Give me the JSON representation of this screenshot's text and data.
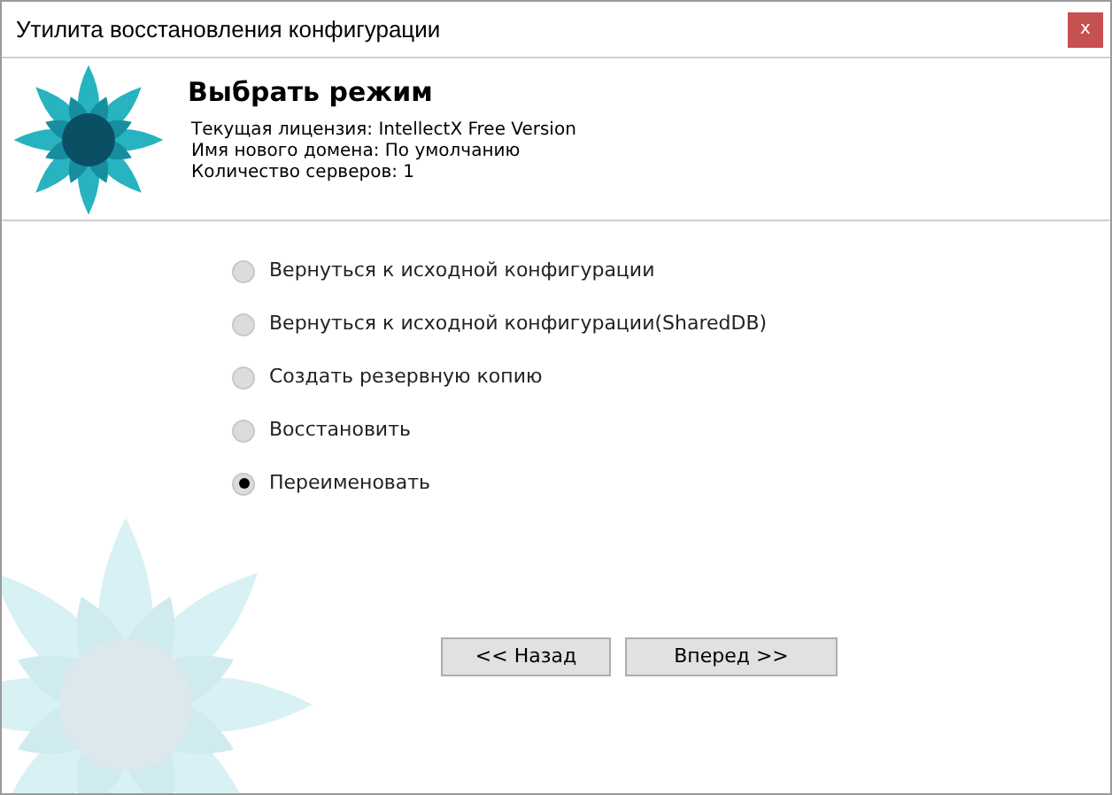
{
  "window": {
    "title": "Утилита восстановления конфигурации",
    "close": "x"
  },
  "header": {
    "title": "Выбрать режим",
    "info": [
      "Текущая лицензия: IntellectX Free Version",
      "Имя нового домена: По умолчанию",
      "Количество серверов: 1"
    ]
  },
  "options": [
    {
      "label": "Вернуться к исходной конфигурации",
      "selected": false
    },
    {
      "label": "Вернуться к исходной конфигурации(SharedDB)",
      "selected": false
    },
    {
      "label": "Создать резервную копию",
      "selected": false
    },
    {
      "label": "Восстановить",
      "selected": false
    },
    {
      "label": "Переименовать",
      "selected": true
    }
  ],
  "buttons": [
    {
      "label": "<< Назад"
    },
    {
      "label": "Вперед >>"
    }
  ]
}
